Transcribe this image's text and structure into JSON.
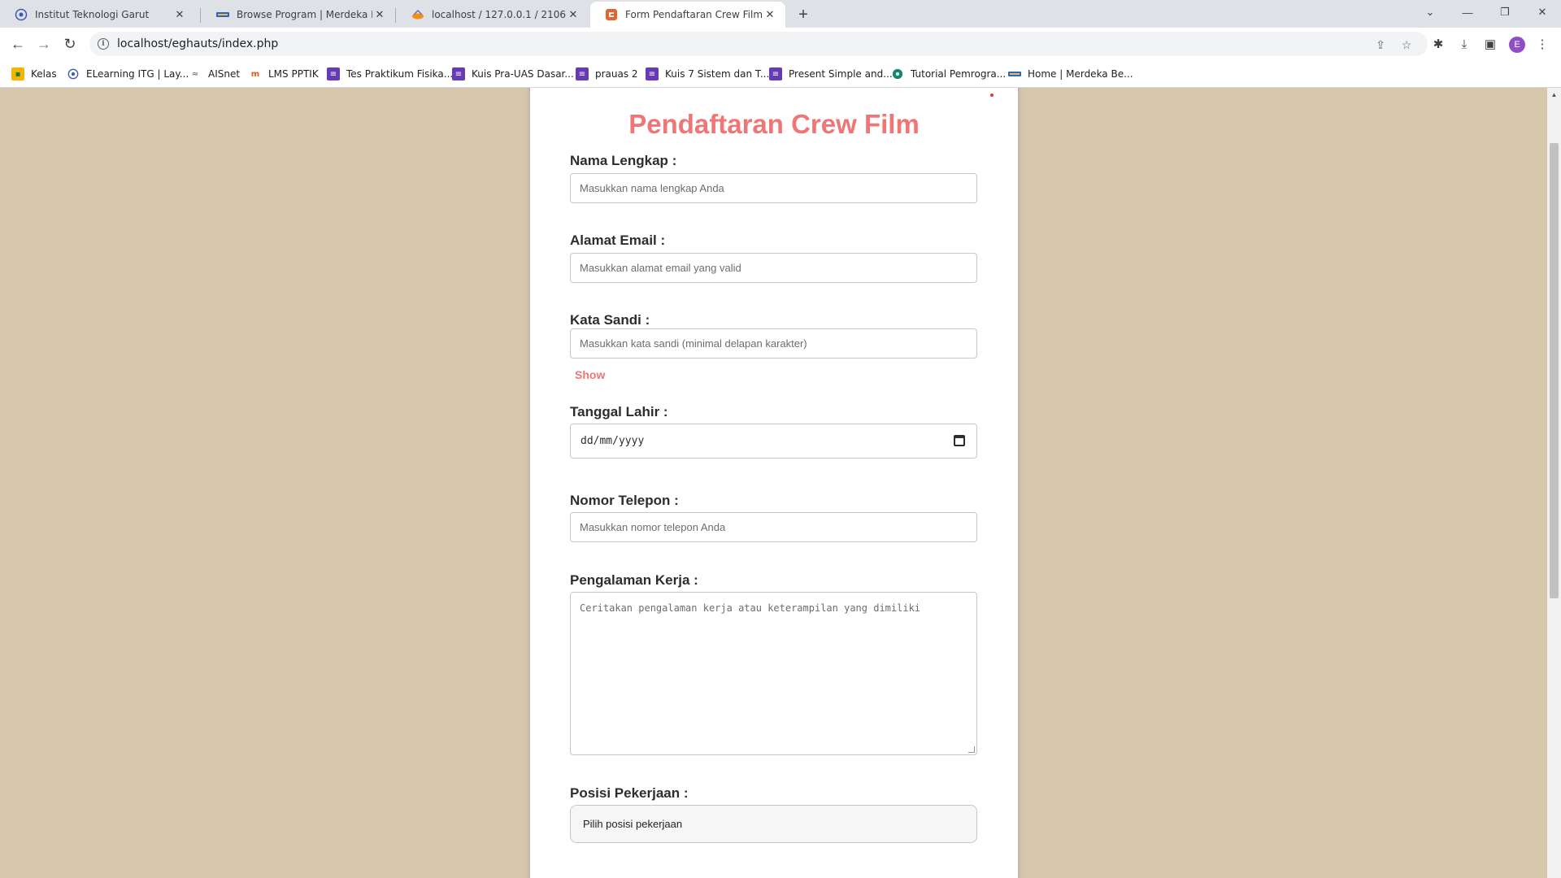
{
  "browser": {
    "tabs": [
      {
        "label": "Institut Teknologi Garut",
        "icon": "itg-logo-icon"
      },
      {
        "label": "Browse Program | Merdeka Bela",
        "icon": "kampus-merdeka-icon"
      },
      {
        "label": "localhost / 127.0.0.1 / 2106058_c",
        "icon": "phpmyadmin-icon"
      },
      {
        "label": "Form Pendaftaran Crew Film",
        "icon": "html5-icon",
        "active": true
      }
    ],
    "new_tab": "+",
    "url": "localhost/eghauts/index.php",
    "profile_initial": "E",
    "bookmarks": [
      {
        "label": "Kelas",
        "icon": "classroom-icon"
      },
      {
        "label": "ELearning ITG | Lay...",
        "icon": "itg-logo-icon"
      },
      {
        "label": "AISnet",
        "icon": "aisnet-icon"
      },
      {
        "label": "LMS PPTIK",
        "icon": "lms-icon"
      },
      {
        "label": "Tes Praktikum Fisika...",
        "icon": "google-forms-icon"
      },
      {
        "label": "Kuis Pra-UAS Dasar...",
        "icon": "google-forms-icon"
      },
      {
        "label": "prauas 2",
        "icon": "google-forms-icon"
      },
      {
        "label": "Kuis 7 Sistem dan T...",
        "icon": "google-forms-icon"
      },
      {
        "label": "Present Simple and...",
        "icon": "google-forms-icon"
      },
      {
        "label": "Tutorial Pemrogra...",
        "icon": "tutorial-icon"
      },
      {
        "label": "Home | Merdeka Be...",
        "icon": "kampus-merdeka-icon"
      }
    ]
  },
  "form": {
    "title": "Pendaftaran Crew Film",
    "nama": {
      "label": "Nama Lengkap :",
      "placeholder": "Masukkan nama lengkap Anda"
    },
    "email": {
      "label": "Alamat Email :",
      "placeholder": "Masukkan alamat email yang valid"
    },
    "sandi": {
      "label": "Kata Sandi :",
      "placeholder": "Masukkan kata sandi (minimal delapan karakter)",
      "toggle": "Show"
    },
    "tanggal": {
      "label": "Tanggal Lahir :",
      "value": "dd/mm/yyyy"
    },
    "telepon": {
      "label": "Nomor Telepon :",
      "placeholder": "Masukkan nomor telepon Anda"
    },
    "pengalaman": {
      "label": "Pengalaman Kerja :",
      "placeholder": "Ceritakan pengalaman kerja atau keterampilan yang dimiliki"
    },
    "posisi": {
      "label": "Posisi Pekerjaan :",
      "selected": "Pilih posisi pekerjaan"
    }
  },
  "colors": {
    "accent": "#f07575",
    "page_bg": "#d7c7ad",
    "card_bg": "#ffffff"
  }
}
